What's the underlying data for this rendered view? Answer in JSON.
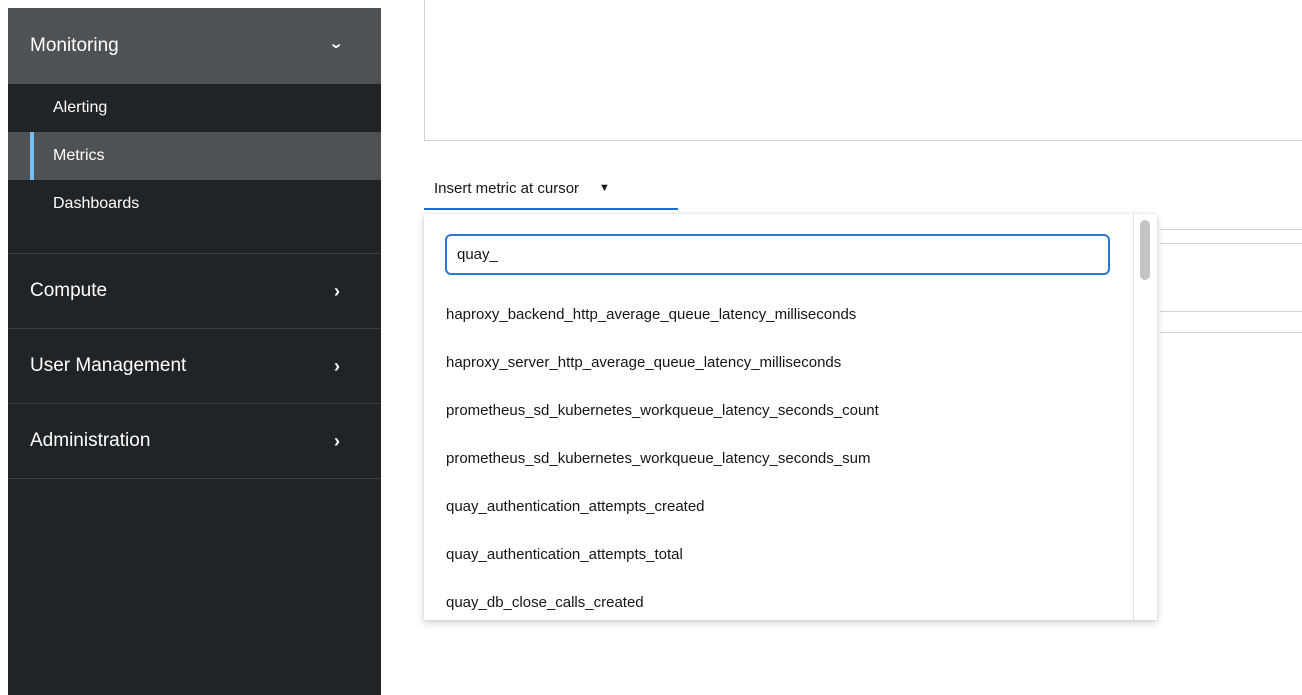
{
  "sidebar": {
    "monitoring": {
      "label": "Monitoring",
      "items": [
        {
          "label": "Alerting"
        },
        {
          "label": "Metrics"
        },
        {
          "label": "Dashboards"
        }
      ]
    },
    "groups": [
      {
        "label": "Compute"
      },
      {
        "label": "User Management"
      },
      {
        "label": "Administration"
      }
    ],
    "active_item": "Metrics"
  },
  "main": {
    "metric_toggle": {
      "label": "Insert metric at cursor"
    },
    "metric_menu": {
      "search_value": "quay_",
      "items": [
        "haproxy_backend_http_average_queue_latency_milliseconds",
        "haproxy_server_http_average_queue_latency_milliseconds",
        "prometheus_sd_kubernetes_workqueue_latency_seconds_count",
        "prometheus_sd_kubernetes_workqueue_latency_seconds_sum",
        "quay_authentication_attempts_created",
        "quay_authentication_attempts_total",
        "quay_db_close_calls_created"
      ]
    }
  },
  "colors": {
    "sidebar_bg": "#212427",
    "sidebar_active_bg": "#4f5255",
    "active_indicator": "#73bcf7",
    "focus_border": "#2b78d0"
  }
}
